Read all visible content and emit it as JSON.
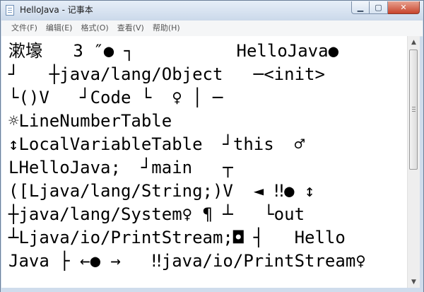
{
  "window": {
    "title": "HelloJava - 记事本",
    "controls": {
      "minimize": "▁",
      "maximize": "▢",
      "close": "✕"
    }
  },
  "menubar": {
    "items": [
      "文件(F)",
      "编辑(E)",
      "格式(O)",
      "查看(V)",
      "帮助(H)"
    ]
  },
  "editor": {
    "lines": [
      "漱壕   3 ″● ┐          HelloJava●",
      "┘   ┼java/lang/Object   ─<init>",
      "└()V   ┘Code └  ♀ │ ─",
      "☼LineNumberTable",
      "↕LocalVariableTable  ┘this  ♂",
      "LHelloJava;  ┘main   ┬",
      "([Ljava/lang/String;)V  ◄ ‼● ↕",
      "┼java/lang/System♀ ¶ ┴   └out",
      "┴Ljava/io/PrintStream;◘ ┤   Hello",
      "Java ├ ←● →   ‼java/io/PrintStream♀"
    ]
  },
  "scrollbar": {
    "up_arrow": "▲",
    "down_arrow": "▼"
  }
}
